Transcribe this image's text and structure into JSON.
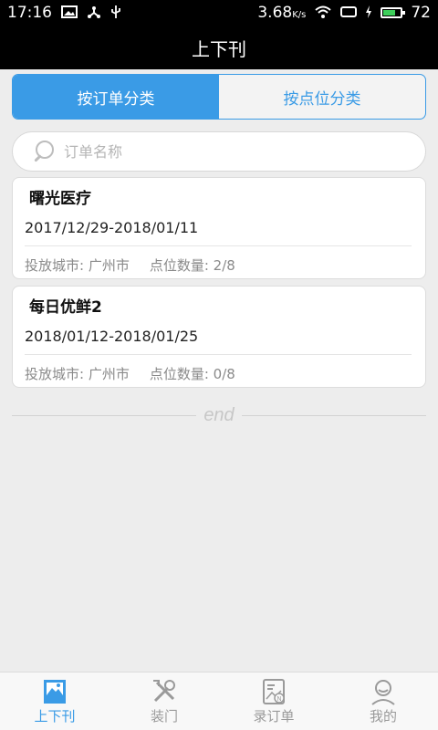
{
  "status_bar": {
    "time": "17:16",
    "speed": "3.68",
    "speed_unit": "K/s",
    "battery": "72",
    "battery_level": 0.72,
    "icons": [
      "image-notification-icon",
      "usb-share-icon",
      "usb-icon",
      "wifi-icon",
      "screen-rotate-icon",
      "charging-icon",
      "battery-icon"
    ]
  },
  "header": {
    "title": "上下刊"
  },
  "segmented": {
    "tabs": [
      {
        "label": "按订单分类",
        "active": true
      },
      {
        "label": "按点位分类",
        "active": false
      }
    ]
  },
  "search": {
    "placeholder": "订单名称",
    "value": ""
  },
  "orders": [
    {
      "name": "曙光医疗",
      "dates": "2017/12/29-2018/01/11",
      "city_label": "投放城市: 广州市",
      "count_label": "点位数量: 2/8"
    },
    {
      "name": "每日优鲜2",
      "dates": "2018/01/12-2018/01/25",
      "city_label": "投放城市: 广州市",
      "count_label": "点位数量: 0/8"
    }
  ],
  "list_end": "end",
  "tabbar": {
    "items": [
      {
        "label": "上下刊",
        "icon": "image-icon",
        "active": true
      },
      {
        "label": "装门",
        "icon": "tools-icon",
        "active": false
      },
      {
        "label": "录订单",
        "icon": "order-entry-icon",
        "active": false
      },
      {
        "label": "我的",
        "icon": "profile-icon",
        "active": false
      }
    ]
  },
  "colors": {
    "accent": "#3a9be6",
    "header_bg": "#000000",
    "page_bg": "#ededed"
  }
}
